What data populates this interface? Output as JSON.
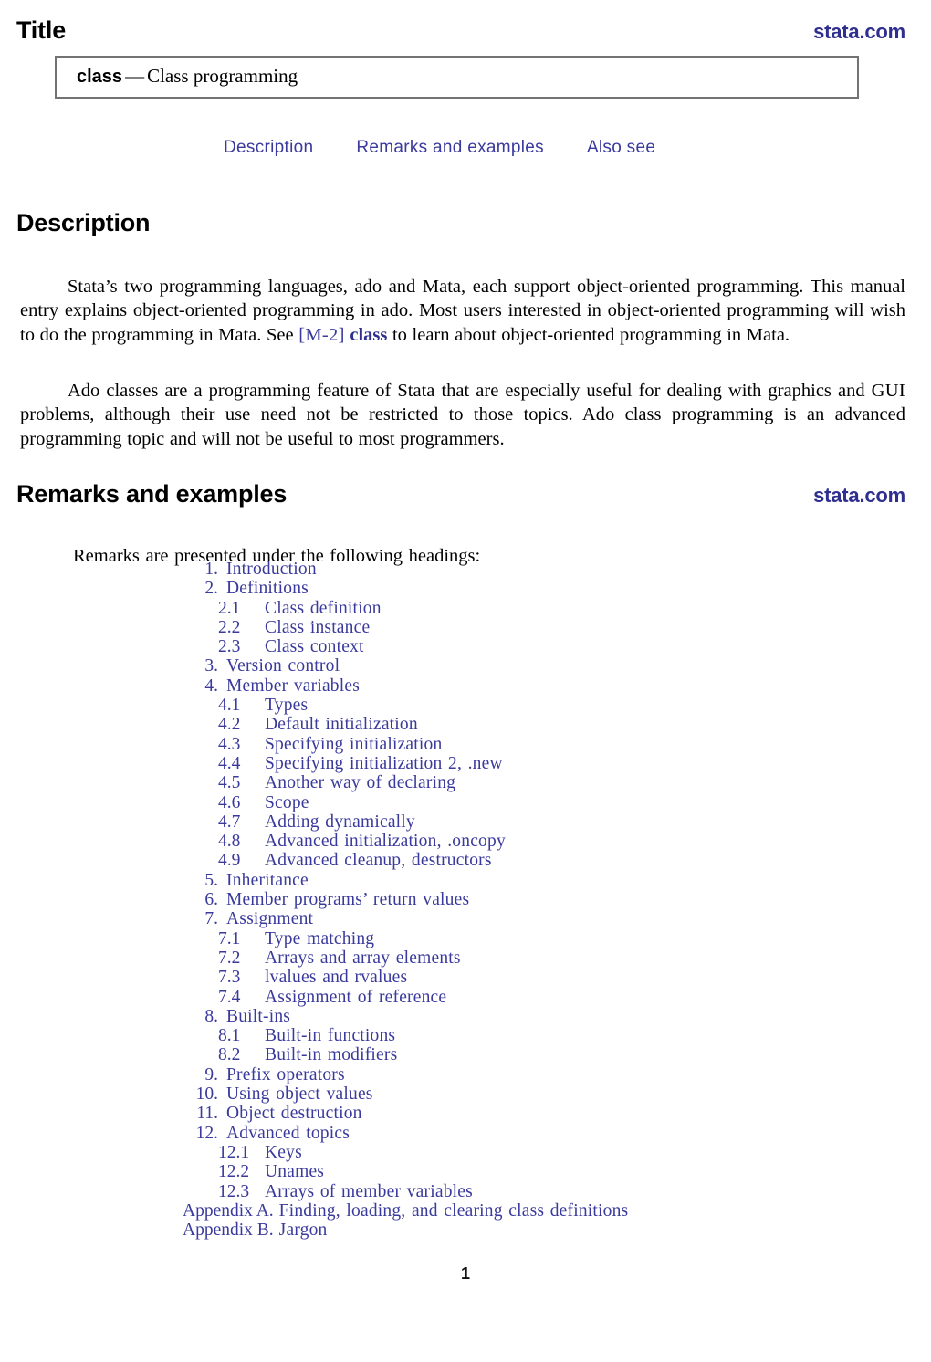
{
  "header": {
    "title": "Title",
    "stata_link": "stata.com"
  },
  "title_box": {
    "command": "class",
    "dash": "—",
    "description": "Class programming"
  },
  "nav_links": [
    {
      "label": "Description"
    },
    {
      "label": "Remarks and examples"
    },
    {
      "label": "Also see"
    }
  ],
  "description": {
    "heading": "Description",
    "paragraph1": {
      "part1": "Stata’s two programming languages, ado and Mata, each support object-oriented programming. This manual entry explains object-oriented programming in ado. Most users interested in object-oriented programming will wish to do the programming in Mata. See ",
      "ref_bracket": "[M-2]",
      "ref_command": "class",
      "part2": " to learn about object-oriented programming in Mata."
    },
    "paragraph2": {
      "part1": "Ado classes are a programming feature of Stata that are especially useful for dealing with graphics and ",
      "smallcaps": "GUI",
      "part2": " problems, although their use need not be restricted to those topics. Ado class programming is an advanced programming topic and will not be useful to most programmers."
    }
  },
  "remarks": {
    "heading": "Remarks and examples",
    "stata_link": "stata.com",
    "intro": "Remarks are presented under the following headings:",
    "toc": [
      {
        "num": "1.",
        "label": "Introduction",
        "level": 1
      },
      {
        "num": "2.",
        "label": "Definitions",
        "level": 1
      },
      {
        "num": "2.1",
        "label": "Class definition",
        "level": 2
      },
      {
        "num": "2.2",
        "label": "Class instance",
        "level": 2
      },
      {
        "num": "2.3",
        "label": "Class context",
        "level": 2
      },
      {
        "num": "3.",
        "label": "Version control",
        "level": 1
      },
      {
        "num": "4.",
        "label": "Member variables",
        "level": 1
      },
      {
        "num": "4.1",
        "label": "Types",
        "level": 2
      },
      {
        "num": "4.2",
        "label": "Default initialization",
        "level": 2
      },
      {
        "num": "4.3",
        "label": "Specifying initialization",
        "level": 2
      },
      {
        "num": "4.4",
        "label": "Specifying initialization 2, .new",
        "level": 2
      },
      {
        "num": "4.5",
        "label": "Another way of declaring",
        "level": 2
      },
      {
        "num": "4.6",
        "label": "Scope",
        "level": 2
      },
      {
        "num": "4.7",
        "label": "Adding dynamically",
        "level": 2
      },
      {
        "num": "4.8",
        "label": "Advanced initialization, .oncopy",
        "level": 2
      },
      {
        "num": "4.9",
        "label": "Advanced cleanup, destructors",
        "level": 2
      },
      {
        "num": "5.",
        "label": "Inheritance",
        "level": 1
      },
      {
        "num": "6.",
        "label": "Member programs’ return values",
        "level": 1
      },
      {
        "num": "7.",
        "label": "Assignment",
        "level": 1
      },
      {
        "num": "7.1",
        "label": "Type matching",
        "level": 2
      },
      {
        "num": "7.2",
        "label": "Arrays and array elements",
        "level": 2
      },
      {
        "num": "7.3",
        "label": "lvalues and rvalues",
        "level": 2
      },
      {
        "num": "7.4",
        "label": "Assignment of reference",
        "level": 2
      },
      {
        "num": "8.",
        "label": "Built-ins",
        "level": 1
      },
      {
        "num": "8.1",
        "label": "Built-in functions",
        "level": 2
      },
      {
        "num": "8.2",
        "label": "Built-in modifiers",
        "level": 2
      },
      {
        "num": "9.",
        "label": "Prefix operators",
        "level": 1
      },
      {
        "num": "10.",
        "label": "Using object values",
        "level": 1
      },
      {
        "num": "11.",
        "label": "Object destruction",
        "level": 1
      },
      {
        "num": "12.",
        "label": "Advanced topics",
        "level": 1
      },
      {
        "num": "12.1",
        "label": "Keys",
        "level": 2
      },
      {
        "num": "12.2",
        "label": "Unames",
        "level": 2
      },
      {
        "num": "12.3",
        "label": "Arrays of member variables",
        "level": 2
      },
      {
        "num": "Appendix A.",
        "label": "Finding, loading, and clearing class definitions",
        "level": 0
      },
      {
        "num": "Appendix B.",
        "label": "Jargon",
        "level": 0
      }
    ]
  },
  "footer": {
    "page_number": "1"
  },
  "colors": {
    "link_blue": "#3a3a9c",
    "brand_blue": "#2f2f8f",
    "box_border": "#737373",
    "text": "#000000"
  }
}
